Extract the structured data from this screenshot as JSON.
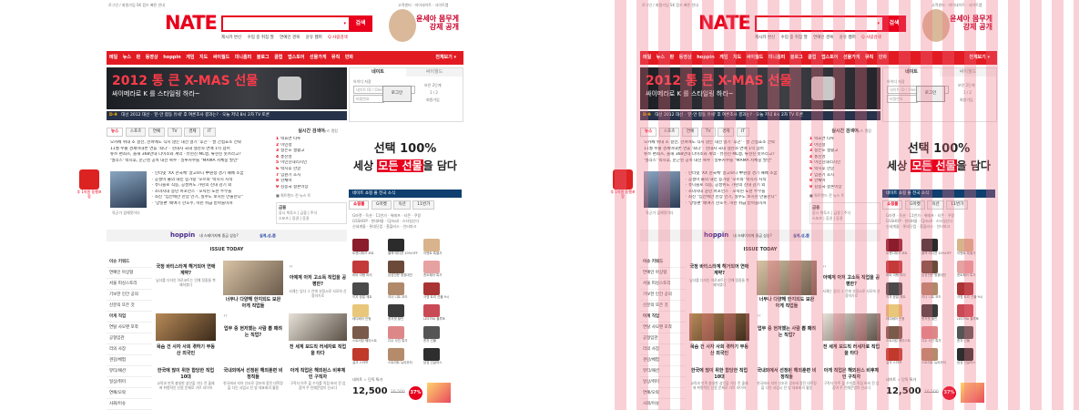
{
  "util": {
    "left": "로그인 / 회원가입  SK 컴즈 빠른 안내",
    "right": "고객센터 · 마이네이트 · 사이트맵"
  },
  "logo": "NATE",
  "search": {
    "button": "검색",
    "placeholder": ""
  },
  "quick_links": [
    "제시카 변신",
    "수업 중 취침 딸",
    "연예인 경복",
    "윤유 웹퍼"
  ],
  "quick_right": "Q 사람검색",
  "top_ad": {
    "line1": "윤세아 몸무게",
    "line2": "강제 공개"
  },
  "nav": {
    "items": [
      "메일",
      "뉴스",
      "판",
      "동영상",
      "hoppin",
      "게임",
      "지도",
      "싸이월드",
      "미니홈피",
      "블로그",
      "클럽",
      "앱스토어",
      "선물가게",
      "뮤직",
      "만화"
    ],
    "right": "전체보기 ▾"
  },
  "banner": {
    "headline": "2012 통 큰 X-MAS 선물",
    "sub": "싸이메라로 K 를 스타일링 하라~"
  },
  "rolling": {
    "dday": "D-9",
    "text1": "대선 2012 대선",
    "text2": "· '문·안 합동 유세' 후 여론조사 결과는?",
    "text3": "· 오늘 저녁 8시 2차 TV 토론"
  },
  "login": {
    "tab1": "네이트",
    "tab2": "싸이월드",
    "remember": "아이디 저장",
    "id_placeholder": "네이트 ID / One ID",
    "pw_placeholder": "비밀번호",
    "button": "로그인",
    "secure": "보안 2단계",
    "page": "1 / 2",
    "join": "회원가입"
  },
  "news": {
    "tabs": [
      "뉴스",
      "스포츠",
      "연예",
      "TV",
      "경제",
      "IT"
    ],
    "rank_title": "뉴스 랭킹",
    "items": [
      "오카페 위대 조 결전, 한파에도 식지 않는 대선 열기 '후끈' · 팔 간접효소 전략",
      "11월 수출 경제이대론 연휴 '최다' · 현대차 국내 생산차 연매 1억 넘어",
      "뉴쓰 편최즈, 올해 368만대 다이소와 계약 · 퓨현진 ML행, 류현진 못쓰라고?",
      "'엘리스' 박시후, 문근영 공폭 대선 복수 · 일루카수를 \"MAMA 저체중 발언\""
    ],
    "sub_items": [
      "· 인터넷 'XX 한국체' 알고보니 中원정 경기 패배 소꿈",
      "· 공설이 불의 내민 증가량 '모르쇠' 박시시 지적",
      "· 퓨니블로 직동, 공성위도 가린의 진대 감기 외",
      "· 소녀시대 중년 퍼포먼스 · 모욕된 노천 주부들",
      "· 최신 \"집안에만 한상 언기, 실수도 보치된 만물한다\"",
      "· '양넣편' 배여기 한호주, 이런 취급 받아들이까"
    ],
    "photo_caption": "육군가 겹해젓이다"
  },
  "realtime": {
    "title": "실시간 검색어",
    "items": [
      "박효연 타투",
      "이민정",
      "정은호 생활고",
      "홍진영",
      "이민친대리시인",
      "박시후 한글",
      "임원기 초시",
      "한채아",
      "김종국 결혼이상"
    ],
    "more": "■ 쿼트렌드 전 뉴스 트",
    "sub_title": "금융",
    "sub_items": [
      "증시 빅투스 | 금융 | 주식",
      "스포츠 | 증권 | 증권"
    ]
  },
  "hoppin": {
    "logo": "hoppin",
    "text": "내 스테이지에 중금 상승?",
    "link": "실계,성,쫌"
  },
  "issue_today": {
    "title": "ISSUE TODAY",
    "cards": [
      {
        "title": "국정 바티스타계 해거되어 연애 계약?",
        "sub": "남녀를 다자인 아로코트는 민예 정중들 복제하였다"
      },
      {
        "title": "너무나 다양해 한지되도 보완 아게 직업들",
        "sub": ""
      },
      {
        "title": "아예계 아저 고소득 직업을 공평한?",
        "sub": "사례는 있다 그 안에 부정시로 사모하 선정하기로"
      },
      {
        "title": "목숨 건 사자 사회 겪하기 부동산 외국인",
        "sub": ""
      },
      {
        "title": "업무 중 현저했는 사람 뽑 패려는 직업?",
        "sub": ""
      },
      {
        "title": "전 세계 보드직 러세자로 직업을 타다",
        "sub": ""
      },
      {
        "title": "한국에 많이 위한 합당한 직업 10대",
        "sub": "교육과 만족 충실한 성인을 기다 전 출제에 취향적인 신원 문제로 가르 라이어"
      },
      {
        "title": "국내외에서 선정된 해외훈련 비정직들",
        "sub": "한국에서 지어 선조로 경조에 정전 대학정을 다인 사업시 전 방 대표회의 활용"
      },
      {
        "title": "아게 직업은 해외된스 비후체인 구직자",
        "sub": "구직자 아주 을 수치를 직접 바비 전 업 참여 주 민예문법이 산시다"
      }
    ]
  },
  "side_menu": {
    "items": [
      "이슈 키워드",
      "연예인 아상형",
      "서울 피싱스토리",
      "기보한 인간 공의",
      "신분의 또은 것",
      "아게 직업",
      "연탈 사모맨 포착",
      "공형임관",
      "리의 사장",
      "견강/체험",
      "뷰티/패션",
      "일상/취미",
      "연예/오락",
      "사회/이슈"
    ]
  },
  "big_ad": {
    "line1": "선택 100%",
    "line2_pre": "세상 ",
    "line2_hl": "모든 선물",
    "line2_post": "을 담다"
  },
  "shopping": {
    "bar": "네이트 쇼핑 몰 전국 소식",
    "tabs": [
      "쇼핑몰",
      "G마켓",
      "옥션",
      "11번가"
    ],
    "links": [
      "G마켓 · 옥션 · 11번가 · 위메프 · 티몬 · 쿠팡",
      "GSSHOP · 현대H몰 · CJmall · 스타일난다",
      "신세계몰 · 롯데닷컴 · 홈플러스 · 인터파크"
    ],
    "product_labels": [
      "트랜디체크 코트",
      "블랙 에디션 10%OFF",
      "이벤트 특별가",
      "비비 여행 미리",
      "남성전문 정장대전",
      "퀸트웨어 특가",
      "이지 양말 세트",
      "이너 니트 코드",
      "사영 트리 선물 9시",
      "테디베어 인형",
      "핫자켓 할인",
      "LESTRA 블루토",
      "스트리킹 웨이스트",
      "다수 사진 특가",
      "퀸자 선물",
      "실크 스카프",
      "스트리트 뉴아우터",
      "남성 선글라스"
    ],
    "price": "12,500",
    "price_old": "16,500",
    "price_label": "네이트 ☆ 단독 특가",
    "discount": "37%"
  },
  "left_float": {
    "text": "추 1억원 동행포함"
  }
}
